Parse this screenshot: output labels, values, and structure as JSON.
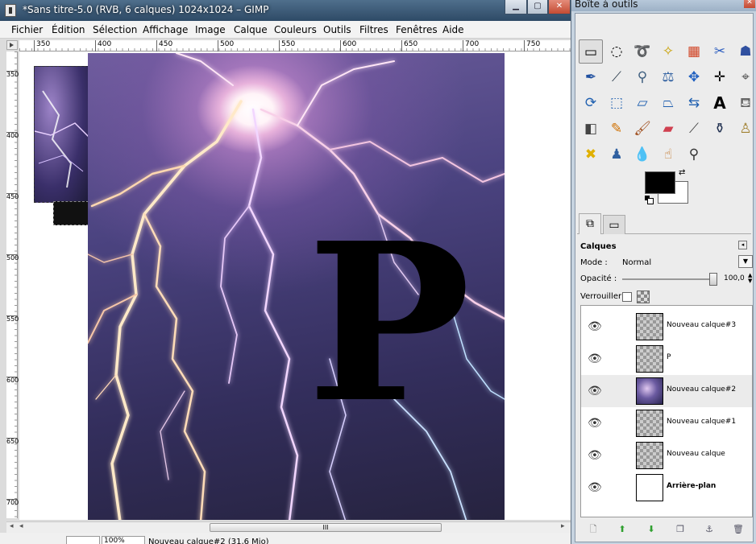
{
  "window": {
    "title": "*Sans titre-5.0 (RVB, 6 calques) 1024x1024 – GIMP"
  },
  "menu": [
    "Fichier",
    "Édition",
    "Sélection",
    "Affichage",
    "Image",
    "Calque",
    "Couleurs",
    "Outils",
    "Filtres",
    "Fenêtres",
    "Aide"
  ],
  "ruler": {
    "h_ticks": [
      "350",
      "400",
      "450",
      "500",
      "550",
      "600",
      "650",
      "700",
      "750"
    ],
    "v_ticks": [
      "350",
      "400",
      "450",
      "500",
      "550",
      "600",
      "650",
      "700"
    ]
  },
  "canvas": {
    "text_layer": "P"
  },
  "scrollbar": {
    "thumb_grip": "III"
  },
  "status": {
    "message": "Nouveau calque#2 (31,6 Mio)",
    "zoom": "100%"
  },
  "toolbox": {
    "title": "Boîte à outils",
    "tools": [
      "rect-select",
      "ellipse-select",
      "free-select",
      "fuzzy-select",
      "color-select",
      "scissors",
      "foreground-select",
      "paths",
      "color-picker",
      "zoom",
      "measure",
      "move",
      "align",
      "crop",
      "rotate",
      "scale",
      "shear",
      "perspective",
      "flip",
      "text",
      "bucket-fill",
      "blend",
      "pencil",
      "paintbrush",
      "eraser",
      "airbrush",
      "ink",
      "clone",
      "heal",
      "perspective-clone",
      "blur",
      "smudge",
      "dodge-burn"
    ],
    "fg_color": "#000000",
    "bg_color": "#ffffff"
  },
  "layers": {
    "title": "Calques",
    "mode_label": "Mode :",
    "mode_value": "Normal",
    "opacity_label": "Opacité :",
    "opacity_value": "100,0",
    "lock_label": "Verrouiller :",
    "items": [
      {
        "name": "Nouveau calque#3",
        "visible": true,
        "selected": false,
        "thumb": "transparent"
      },
      {
        "name": "P",
        "visible": true,
        "selected": false,
        "thumb": "transparent"
      },
      {
        "name": "Nouveau calque#2",
        "visible": true,
        "selected": true,
        "thumb": "lightning"
      },
      {
        "name": "Nouveau calque#1",
        "visible": true,
        "selected": false,
        "thumb": "transparent"
      },
      {
        "name": "Nouveau calque",
        "visible": true,
        "selected": false,
        "thumb": "transparent"
      },
      {
        "name": "Arrière-plan",
        "visible": true,
        "selected": false,
        "thumb": "white",
        "bold": true
      }
    ]
  }
}
